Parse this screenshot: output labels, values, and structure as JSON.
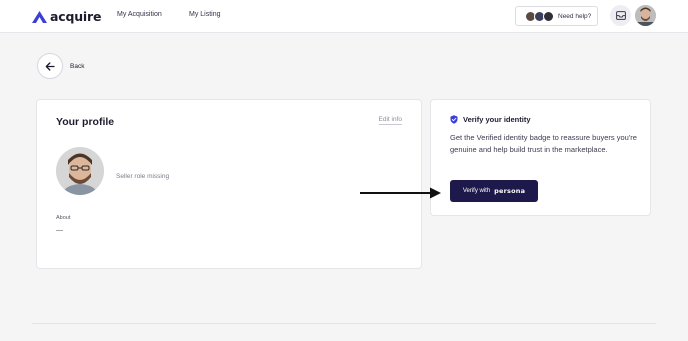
{
  "brand": {
    "name": "acquire",
    "accent": "#3b3fd8",
    "dark": "#1d1a4b"
  },
  "nav": {
    "links": [
      {
        "label": "My Acquisition"
      },
      {
        "label": "My Listing"
      }
    ],
    "help_label": "Need help?",
    "mail_icon": "mail-icon"
  },
  "back": {
    "label": "Back",
    "icon": "arrow-left-icon"
  },
  "profile": {
    "title": "Your profile",
    "edit_label": "Edit info",
    "role": "Seller role missing",
    "about_label": "About",
    "about_value": "—"
  },
  "verify": {
    "icon": "shield-check-icon",
    "title": "Verify your identity",
    "description": "Get the Verified identity badge to reassure buyers you're genuine and help build trust in the marketplace.",
    "button_label": "Verify with",
    "button_brand": "persona"
  }
}
